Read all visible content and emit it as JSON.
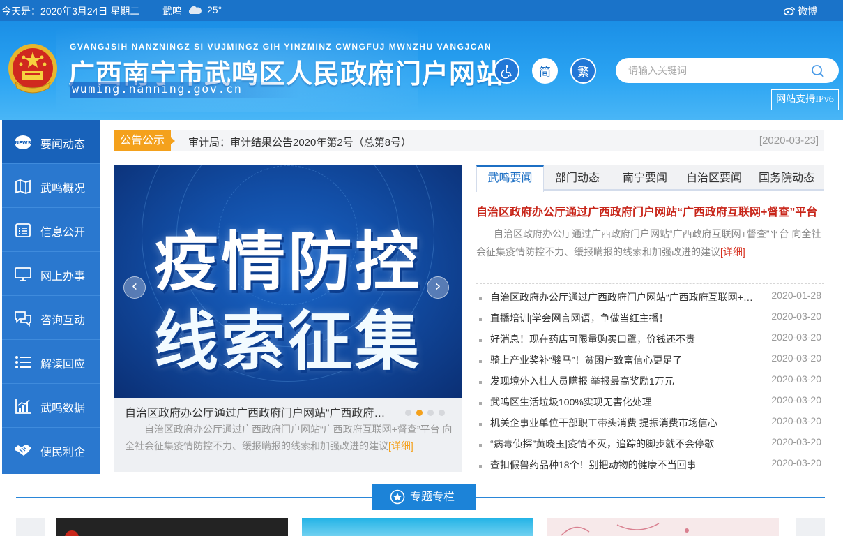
{
  "topbar": {
    "date": "今天是：2020年3月24日 星期二",
    "city": "武鸣",
    "weather_icon": "cloud-icon",
    "temperature": "25°",
    "weibo_label": "微博"
  },
  "header": {
    "pinyin": "GVANGJSIH NANZNINGZ SI VUJMINGZ GIH YINZMINZ CWNGFUJ MWNZHU VANGJCAN",
    "site_name": "广西南宁市武鸣区人民政府门户网站",
    "domain": "wuming.nanning.gov.cn",
    "accessibility_icon": "wheelchair-icon",
    "simplified_label": "简",
    "traditional_label": "繁",
    "search_placeholder": "请输入关键词",
    "ipv6_label": "网站支持IPv6"
  },
  "sidebar": {
    "items": [
      {
        "label": "要闻动态",
        "icon": "news-icon"
      },
      {
        "label": "武鸣概况",
        "icon": "map-icon"
      },
      {
        "label": "信息公开",
        "icon": "document-list-icon"
      },
      {
        "label": "网上办事",
        "icon": "monitor-icon"
      },
      {
        "label": "咨询互动",
        "icon": "chat-icon"
      },
      {
        "label": "解读回应",
        "icon": "list-icon"
      },
      {
        "label": "武鸣数据",
        "icon": "bar-chart-icon"
      },
      {
        "label": "便民利企",
        "icon": "handshake-icon"
      }
    ]
  },
  "notice": {
    "tag": "公告公示",
    "text": "审计局：审计结果公告2020年第2号（总第8号）",
    "date": "[2020-03-23]"
  },
  "carousel": {
    "slide_line1": "疫情防控",
    "slide_line2": "线索征集",
    "caption_title": "自治区政府办公厅通过广西政府门户网站“广西政府互联网+督查”平台",
    "caption_desc": "自治区政府办公厅通过广西政府门户网站“广西政府互联网+督查”平台 向全社会征集疫情防控不力、缓报瞒报的线索和加强改进的建议",
    "more_label": "[详细]",
    "active_dot": 1
  },
  "news": {
    "tabs": [
      "武鸣要闻",
      "部门动态",
      "南宁要闻",
      "自治区要闻",
      "国务院动态"
    ],
    "headline": "自治区政府办公厅通过广西政府门户网站“广西政府互联网+督查”平台",
    "headline_desc": "自治区政府办公厅通过广西政府门户网站“广西政府互联网+督查”平台 向全社会征集疫情防控不力、缓报瞒报的线索和加强改进的建议",
    "more_label": "[详细]",
    "items": [
      {
        "title": "自治区政府办公厅通过广西政府门户网站“广西政府互联网+督查”平台",
        "date": "2020-01-28"
      },
      {
        "title": "直播培训|学会网言网语，争做当红主播！",
        "date": "2020-03-20"
      },
      {
        "title": "好消息！现在药店可限量购买口罩，价钱还不贵",
        "date": "2020-03-20"
      },
      {
        "title": "骑上产业奖补“骏马”！贫困户致富信心更足了",
        "date": "2020-03-20"
      },
      {
        "title": "发现境外入桂人员瞒报 举报最高奖励1万元",
        "date": "2020-03-20"
      },
      {
        "title": "武鸣区生活垃圾100%实现无害化处理",
        "date": "2020-03-20"
      },
      {
        "title": "机关企事业单位干部职工带头消费 提振消费市场信心",
        "date": "2020-03-20"
      },
      {
        "title": "“病毒侦探”黄晓玉|疫情不灭，追踪的脚步就不会停歇",
        "date": "2020-03-20"
      },
      {
        "title": "查扣假兽药品种18个！别把动物的健康不当回事",
        "date": "2020-03-20"
      }
    ]
  },
  "special": {
    "label": "专题专栏",
    "icon": "star-icon"
  },
  "colors": {
    "brand_blue": "#1a73c9",
    "accent_orange": "#f4a11c",
    "headline_red": "#c8261a"
  }
}
